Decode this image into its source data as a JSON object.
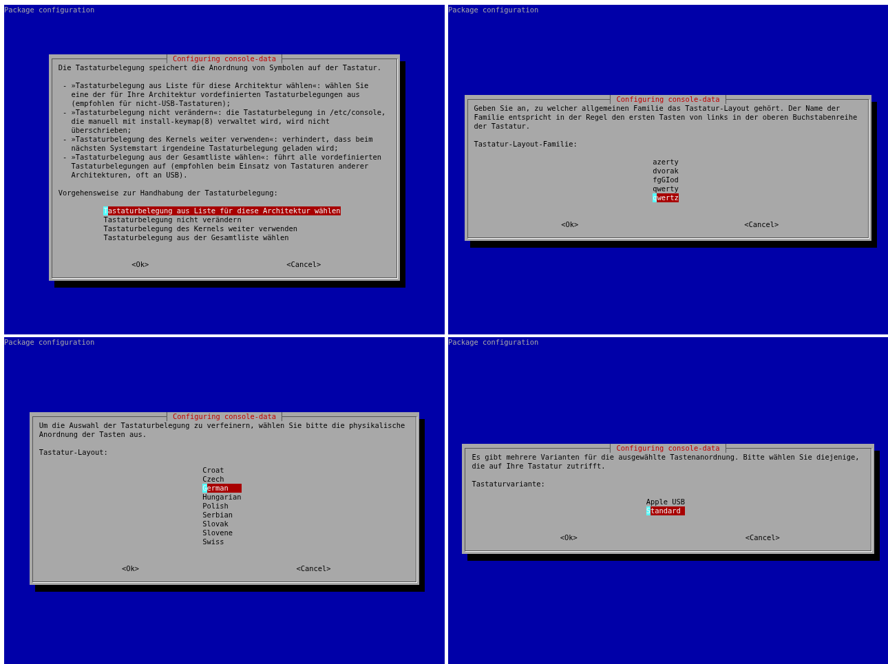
{
  "screens": [
    {
      "header": "Package configuration",
      "dialog": {
        "title": "Configuring console-data",
        "intro": [
          "Die Tastaturbelegung speichert die Anordnung von Symbolen auf der Tastatur."
        ],
        "bullets": [
          " - »Tastaturbelegung aus Liste für diese Architektur wählen«: wählen Sie\n   eine der für Ihre Architektur vordefinierten Tastaturbelegungen aus\n   (empfohlen für nicht-USB-Tastaturen);",
          " - »Tastaturbelegung nicht verändern«: die Tastaturbelegung in /etc/console,\n   die manuell mit install-keymap(8) verwaltet wird, wird nicht\n   überschrieben;",
          " - »Tastaturbelegung des Kernels weiter verwenden«: verhindert, dass beim\n   nächsten Systemstart irgendeine Tastaturbelegung geladen wird;",
          " - »Tastaturbelegung aus der Gesamtliste wählen«: führt alle vordefinierten\n   Tastaturbelegungen auf (empfohlen beim Einsatz von Tastaturen anderer\n   Architekturen, oft an USB)."
        ],
        "prompt": "Vorgehensweise zur Handhabung der Tastaturbelegung:",
        "options": [
          {
            "label": "Tastaturbelegung aus Liste für diese Architektur wählen",
            "selected": true
          },
          {
            "label": "Tastaturbelegung nicht verändern",
            "selected": false
          },
          {
            "label": "Tastaturbelegung des Kernels weiter verwenden",
            "selected": false
          },
          {
            "label": "Tastaturbelegung aus der Gesamtliste wählen",
            "selected": false
          }
        ],
        "buttons": [
          "<Ok>",
          "<Cancel>"
        ]
      }
    },
    {
      "header": "Package configuration",
      "dialog": {
        "title": "Configuring console-data",
        "intro": [
          "Geben Sie an, zu welcher allgemeinen Familie das Tastatur-Layout gehört. Der Name der\nFamilie entspricht in der Regel den ersten Tasten von links in der oberen Buchstabenreihe\nder Tastatur."
        ],
        "prompt": "Tastatur-Layout-Familie:",
        "options": [
          {
            "label": "azerty",
            "selected": false
          },
          {
            "label": "dvorak",
            "selected": false
          },
          {
            "label": "fgGIod",
            "selected": false
          },
          {
            "label": "qwerty",
            "selected": false
          },
          {
            "label": "qwertz",
            "selected": true
          }
        ],
        "buttons": [
          "<Ok>",
          "<Cancel>"
        ]
      }
    },
    {
      "header": "Package configuration",
      "dialog": {
        "title": "Configuring console-data",
        "intro": [
          "Um die Auswahl der Tastaturbelegung zu verfeinern, wählen Sie bitte die physikalische\nAnordnung der Tasten aus."
        ],
        "prompt": "Tastatur-Layout:",
        "options": [
          {
            "label": "Croat",
            "selected": false
          },
          {
            "label": "Czech",
            "selected": false
          },
          {
            "label": "German",
            "selected": true
          },
          {
            "label": "Hungarian",
            "selected": false
          },
          {
            "label": "Polish",
            "selected": false
          },
          {
            "label": "Serbian",
            "selected": false
          },
          {
            "label": "Slovak",
            "selected": false
          },
          {
            "label": "Slovene",
            "selected": false
          },
          {
            "label": "Swiss",
            "selected": false
          }
        ],
        "buttons": [
          "<Ok>",
          "<Cancel>"
        ]
      }
    },
    {
      "header": "Package configuration",
      "dialog": {
        "title": "Configuring console-data",
        "intro": [
          "Es gibt mehrere Varianten für die ausgewählte Tastenanordnung. Bitte wählen Sie diejenige,\ndie auf Ihre Tastatur zutrifft."
        ],
        "prompt": "Tastaturvariante:",
        "options": [
          {
            "label": "Apple USB",
            "selected": false
          },
          {
            "label": "Standard",
            "selected": true
          }
        ],
        "buttons": [
          "<Ok>",
          "<Cancel>"
        ]
      }
    }
  ]
}
